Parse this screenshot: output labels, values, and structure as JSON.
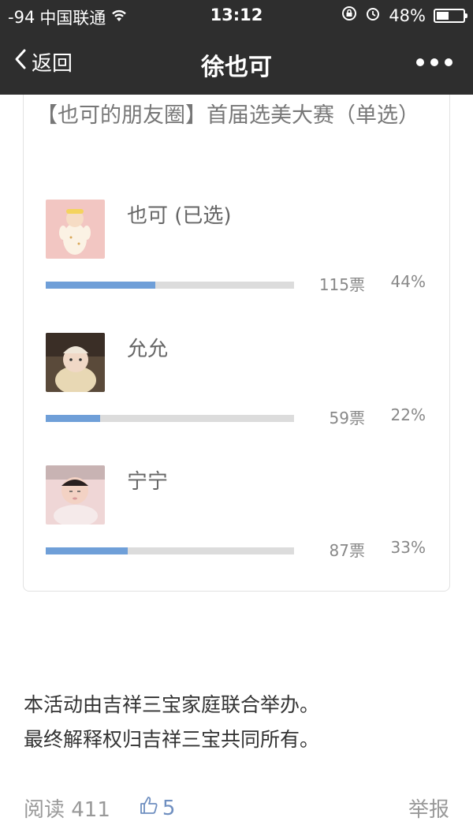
{
  "status_bar": {
    "signal": "-94",
    "carrier": "中国联通",
    "time": "13:12",
    "battery": "48%",
    "battery_level": 0.48
  },
  "nav": {
    "back_label": "返回",
    "title": "徐也可"
  },
  "vote": {
    "title": "【也可的朋友圈】首届选美大赛（单选）",
    "options": [
      {
        "label": "也可 (已选)",
        "votes": "115票",
        "percent": "44%",
        "fraction": 0.44
      },
      {
        "label": "允允",
        "votes": "59票",
        "percent": "22%",
        "fraction": 0.22
      },
      {
        "label": "宁宁",
        "votes": "87票",
        "percent": "33%",
        "fraction": 0.33
      }
    ]
  },
  "notice": {
    "line1": "本活动由吉祥三宝家庭联合举办。",
    "line2": "最终解释权归吉祥三宝共同所有。"
  },
  "footer": {
    "read_label": "阅读 411",
    "likes": "5",
    "report_label": "举报"
  },
  "colors": {
    "topbar": "#2e2e2e",
    "bar_fill": "#6f9fd8",
    "bar_track": "#dcdcdc"
  }
}
